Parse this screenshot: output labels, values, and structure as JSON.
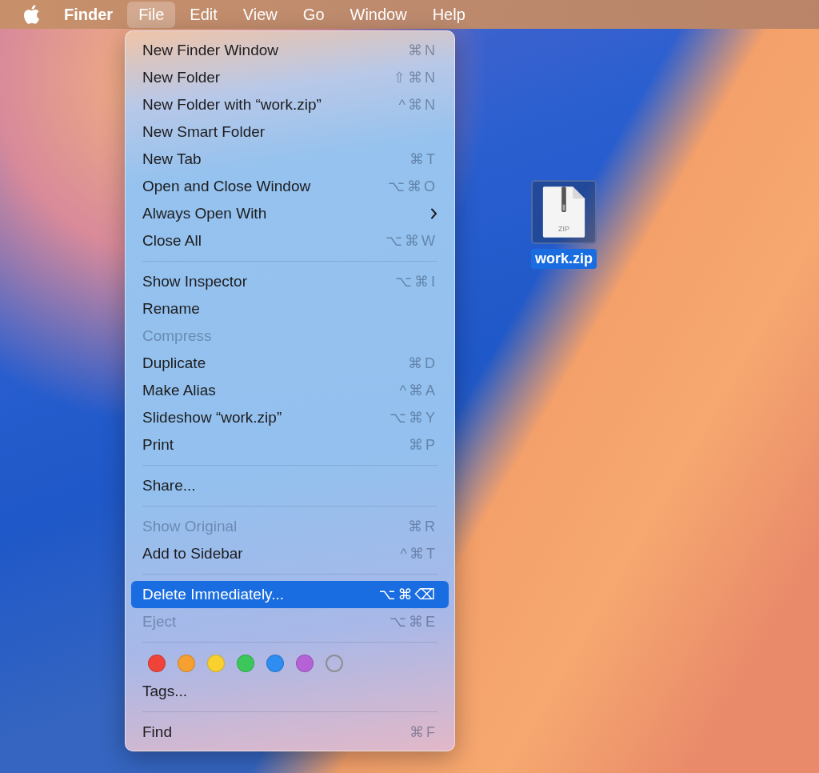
{
  "menu_bar": [
    {
      "label": "Finder",
      "kind": "app",
      "selected": false
    },
    {
      "label": "File",
      "kind": "menu",
      "selected": true
    },
    {
      "label": "Edit",
      "kind": "menu",
      "selected": false
    },
    {
      "label": "View",
      "kind": "menu",
      "selected": false
    },
    {
      "label": "Go",
      "kind": "menu",
      "selected": false
    },
    {
      "label": "Window",
      "kind": "menu",
      "selected": false
    },
    {
      "label": "Help",
      "kind": "menu",
      "selected": false
    }
  ],
  "file_menu": [
    {
      "kind": "item",
      "label": "New Finder Window",
      "shortcut": "⌘N",
      "disabled": false,
      "selected": false,
      "submenu": false
    },
    {
      "kind": "item",
      "label": "New Folder",
      "shortcut": "⇧⌘N",
      "disabled": false,
      "selected": false,
      "submenu": false
    },
    {
      "kind": "item",
      "label": "New Folder with “work.zip”",
      "shortcut": "^⌘N",
      "disabled": false,
      "selected": false,
      "submenu": false
    },
    {
      "kind": "item",
      "label": "New Smart Folder",
      "disabled": false,
      "selected": false,
      "submenu": false
    },
    {
      "kind": "item",
      "label": "New Tab",
      "shortcut": "⌘T",
      "disabled": false,
      "selected": false,
      "submenu": false
    },
    {
      "kind": "item",
      "label": "Open and Close Window",
      "shortcut": "⌥⌘O",
      "disabled": false,
      "selected": false,
      "submenu": false
    },
    {
      "kind": "item",
      "label": "Always Open With",
      "disabled": false,
      "selected": false,
      "submenu": true
    },
    {
      "kind": "item",
      "label": "Close All",
      "shortcut": "⌥⌘W",
      "disabled": false,
      "selected": false,
      "submenu": false
    },
    {
      "kind": "separator"
    },
    {
      "kind": "item",
      "label": "Show Inspector",
      "shortcut": "⌥⌘I",
      "disabled": false,
      "selected": false,
      "submenu": false
    },
    {
      "kind": "item",
      "label": "Rename",
      "disabled": false,
      "selected": false,
      "submenu": false
    },
    {
      "kind": "item",
      "label": "Compress",
      "disabled": true,
      "selected": false,
      "submenu": false
    },
    {
      "kind": "item",
      "label": "Duplicate",
      "shortcut": "⌘D",
      "disabled": false,
      "selected": false,
      "submenu": false
    },
    {
      "kind": "item",
      "label": "Make Alias",
      "shortcut": "^⌘A",
      "disabled": false,
      "selected": false,
      "submenu": false
    },
    {
      "kind": "item",
      "label": "Slideshow “work.zip”",
      "shortcut": "⌥⌘Y",
      "disabled": false,
      "selected": false,
      "submenu": false
    },
    {
      "kind": "item",
      "label": "Print",
      "shortcut": "⌘P",
      "disabled": false,
      "selected": false,
      "submenu": false
    },
    {
      "kind": "separator"
    },
    {
      "kind": "item",
      "label": "Share...",
      "disabled": false,
      "selected": false,
      "submenu": false
    },
    {
      "kind": "separator"
    },
    {
      "kind": "item",
      "label": "Show Original",
      "shortcut": "⌘R",
      "disabled": true,
      "selected": false,
      "submenu": false
    },
    {
      "kind": "item",
      "label": "Add to Sidebar",
      "shortcut": "^⌘T",
      "disabled": false,
      "selected": false,
      "submenu": false
    },
    {
      "kind": "separator"
    },
    {
      "kind": "item",
      "label": "Delete Immediately...",
      "shortcut": "⌥⌘⌫",
      "disabled": false,
      "selected": true,
      "submenu": false
    },
    {
      "kind": "item",
      "label": "Eject",
      "shortcut": "⌥⌘E",
      "disabled": true,
      "selected": false,
      "submenu": false
    },
    {
      "kind": "separator"
    },
    {
      "kind": "tags",
      "tags": [
        {
          "color": "#f0443a",
          "hollow": false
        },
        {
          "color": "#f5a030",
          "hollow": false
        },
        {
          "color": "#f8d030",
          "hollow": false
        },
        {
          "color": "#3cc75a",
          "hollow": false
        },
        {
          "color": "#2f8cf0",
          "hollow": false
        },
        {
          "color": "#b562d6",
          "hollow": false
        },
        {
          "color": "#8e8e93",
          "hollow": true
        }
      ]
    },
    {
      "kind": "item",
      "label": "Tags...",
      "disabled": false,
      "selected": false,
      "submenu": false
    },
    {
      "kind": "separator"
    },
    {
      "kind": "item",
      "label": "Find",
      "shortcut": "⌘F",
      "disabled": false,
      "selected": false,
      "submenu": false
    }
  ],
  "desktop_file": {
    "label": "work.zip",
    "badge": "ZIP",
    "selected": true
  }
}
